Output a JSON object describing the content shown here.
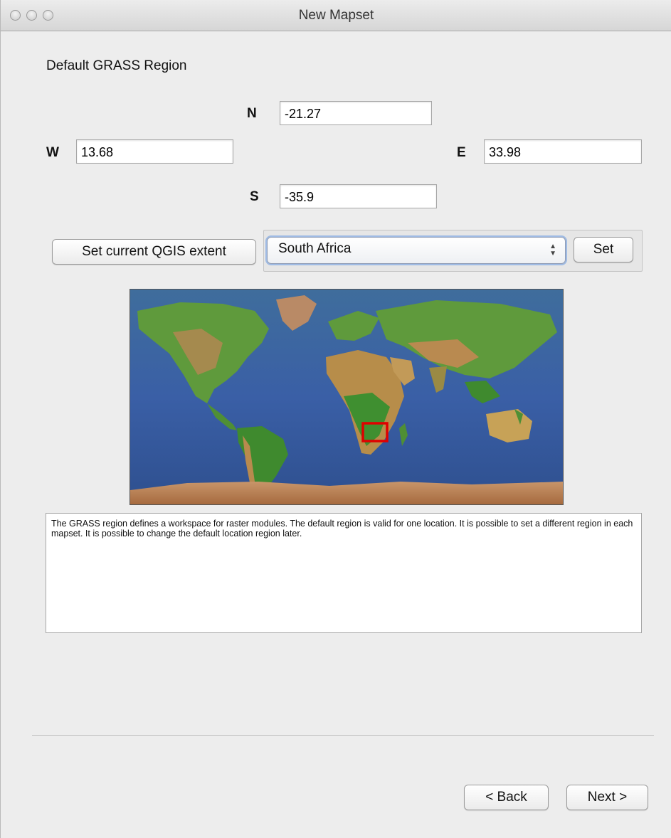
{
  "window": {
    "title": "New Mapset",
    "controls": [
      "close-icon",
      "minimize-icon",
      "zoom-icon"
    ]
  },
  "region": {
    "heading": "Default GRASS Region",
    "north": {
      "label": "N",
      "value": "-21.27"
    },
    "west": {
      "label": "W",
      "value": "13.68"
    },
    "east": {
      "label": "E",
      "value": "33.98"
    },
    "south": {
      "label": "S",
      "value": "-35.9"
    }
  },
  "extent": {
    "set_current_label": "Set current QGIS extent",
    "country_selected": "South Africa",
    "set_label": "Set"
  },
  "map": {
    "highlight_color": "#e00000",
    "region_bounds": {
      "west": 13.68,
      "east": 33.98,
      "north": -21.27,
      "south": -35.9
    }
  },
  "info": {
    "text": "The GRASS region defines a workspace for raster modules. The default region is valid for one location. It is possible to set a different region in each mapset. It is possible to change the default location region later."
  },
  "navigation": {
    "back_label": "< Back",
    "next_label": "Next >"
  }
}
